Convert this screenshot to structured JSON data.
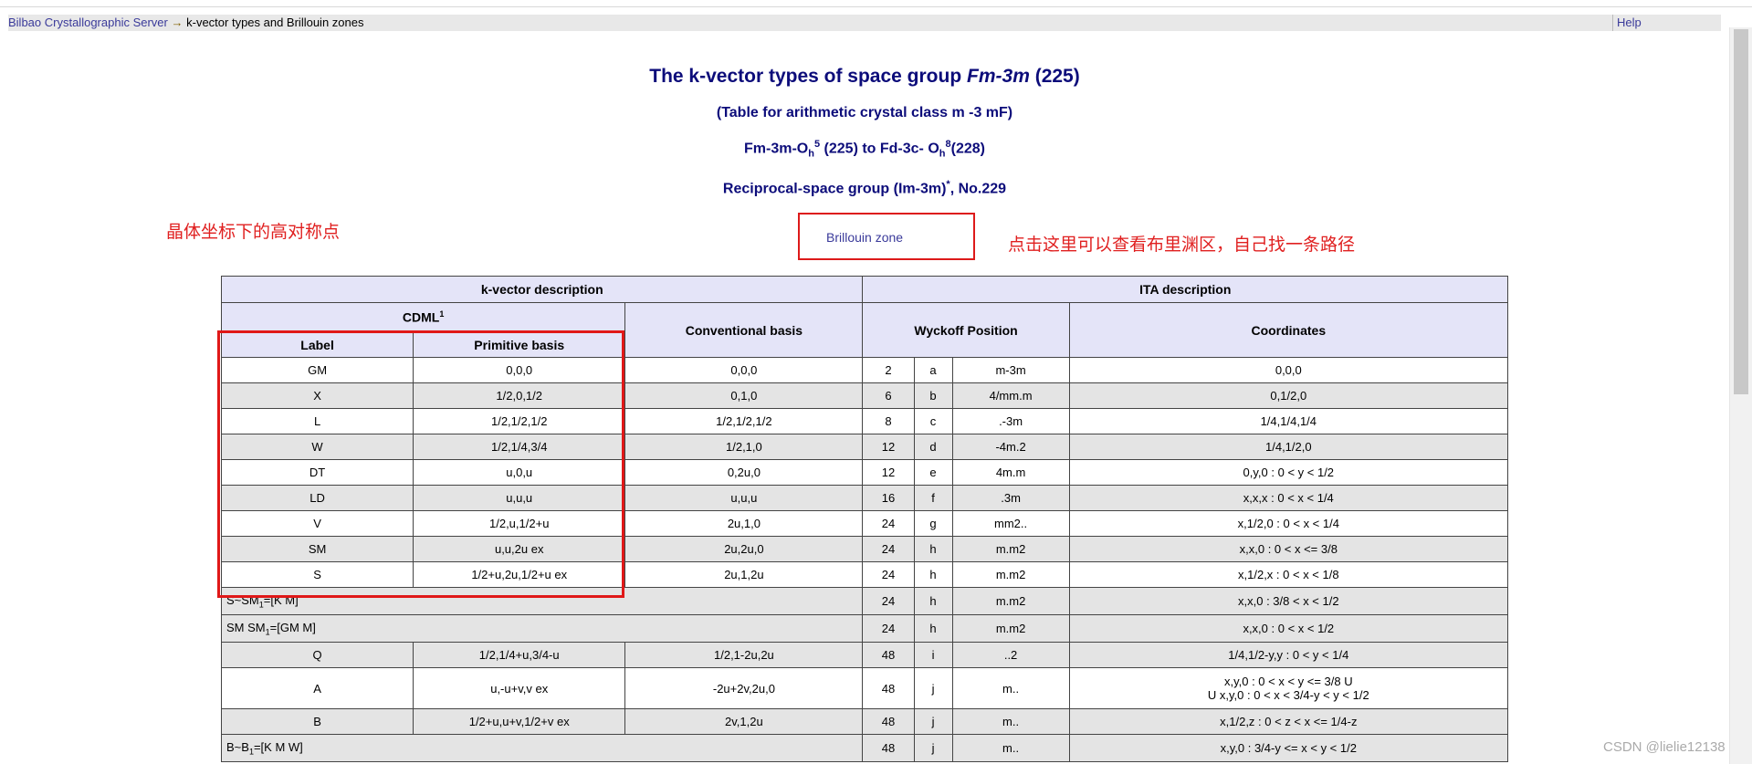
{
  "topbar": {
    "server_link": "Bilbao Crystallographic Server",
    "arrow": "→",
    "current_page": "k-vector types and Brillouin zones",
    "help": "Help"
  },
  "titles": {
    "title_pre": "The k-vector types of space group ",
    "title_group": "Fm-3m",
    "title_post": " (225)",
    "subtitle": "(Table for arithmetic crystal class m -3 mF)",
    "line3": {
      "a": "Fm-3m-O",
      "a_sub": "h",
      "a_sup": "5",
      "b": " (225) to Fd-3c- O",
      "b_sub": "h",
      "b_sup": "8",
      "c": "(228)"
    },
    "line4": {
      "a": "Reciprocal-space group (Im-3m)",
      "a_sup": "*",
      "b": ", No.229"
    }
  },
  "annotations": {
    "left_note": "晶体坐标下的高对称点",
    "right_note": "点击这里可以查看布里渊区，自己找一条路径"
  },
  "brillouin_link": "Brillouin zone",
  "table": {
    "header": {
      "kvec": "k-vector description",
      "ita": "ITA description",
      "cdml": "CDML",
      "cdml_sup": "1",
      "label": "Label",
      "primitive": "Primitive basis",
      "conventional": "Conventional basis",
      "wyckoff": "Wyckoff Position",
      "coordinates": "Coordinates"
    },
    "rows": [
      {
        "label": "GM",
        "prim": "0,0,0",
        "conv": "0,0,0",
        "mult": "2",
        "letter": "a",
        "sym": "m-3m",
        "coord": "0,0,0"
      },
      {
        "label": "X",
        "prim": "1/2,0,1/2",
        "conv": "0,1,0",
        "mult": "6",
        "letter": "b",
        "sym": "4/mm.m",
        "coord": "0,1/2,0"
      },
      {
        "label": "L",
        "prim": "1/2,1/2,1/2",
        "conv": "1/2,1/2,1/2",
        "mult": "8",
        "letter": "c",
        "sym": ".-3m",
        "coord": "1/4,1/4,1/4"
      },
      {
        "label": "W",
        "prim": "1/2,1/4,3/4",
        "conv": "1/2,1,0",
        "mult": "12",
        "letter": "d",
        "sym": "-4m.2",
        "coord": "1/4,1/2,0"
      },
      {
        "label": "DT",
        "prim": "u,0,u",
        "conv": "0,2u,0",
        "mult": "12",
        "letter": "e",
        "sym": "4m.m",
        "coord": "0,y,0 : 0 < y < 1/2"
      },
      {
        "label": "LD",
        "prim": "u,u,u",
        "conv": "u,u,u",
        "mult": "16",
        "letter": "f",
        "sym": ".3m",
        "coord": "x,x,x : 0 < x < 1/4"
      },
      {
        "label": "V",
        "prim": "1/2,u,1/2+u",
        "conv": "2u,1,0",
        "mult": "24",
        "letter": "g",
        "sym": "mm2..",
        "coord": "x,1/2,0 : 0 < x < 1/4"
      },
      {
        "label": "SM",
        "prim": "u,u,2u ex",
        "conv": "2u,2u,0",
        "mult": "24",
        "letter": "h",
        "sym": "m.m2",
        "coord": "x,x,0 : 0 < x <= 3/8"
      },
      {
        "label": "S",
        "prim": "1/2+u,2u,1/2+u ex",
        "conv": "2u,1,2u",
        "mult": "24",
        "letter": "h",
        "sym": "m.m2",
        "coord": "x,1/2,x : 0 < x < 1/8"
      },
      {
        "span_text": "S~SM",
        "span_sub": "1",
        "span_tail": "=[K M]",
        "mult": "24",
        "letter": "h",
        "sym": "m.m2",
        "coord": "x,x,0 : 3/8 < x < 1/2"
      },
      {
        "span_text": "SM SM",
        "span_sub": "1",
        "span_tail": "=[GM M]",
        "mult": "24",
        "letter": "h",
        "sym": "m.m2",
        "coord": "x,x,0 : 0 < x < 1/2"
      },
      {
        "label": "Q",
        "prim": "1/2,1/4+u,3/4-u",
        "conv": "1/2,1-2u,2u",
        "mult": "48",
        "letter": "i",
        "sym": "..2",
        "coord": "1/4,1/2-y,y : 0 < y < 1/4"
      },
      {
        "label": "A",
        "prim": "u,-u+v,v ex",
        "conv": "-2u+2v,2u,0",
        "mult": "48",
        "letter": "j",
        "sym": "m..",
        "coord": "x,y,0 : 0 < x < y <= 3/8 U",
        "coord2": "U x,y,0 : 0 < x < 3/4-y < y < 1/2"
      },
      {
        "label": "B",
        "prim": "1/2+u,u+v,1/2+v ex",
        "conv": "2v,1,2u",
        "mult": "48",
        "letter": "j",
        "sym": "m..",
        "coord": "x,1/2,z : 0 < z < x <= 1/4-z"
      },
      {
        "span_text": "B~B",
        "span_sub": "1",
        "span_tail": "=[K M W]",
        "mult": "48",
        "letter": "j",
        "sym": "m..",
        "coord": "x,y,0 : 3/4-y <= x < y < 1/2"
      }
    ]
  },
  "watermark": "CSDN @lielie12138"
}
